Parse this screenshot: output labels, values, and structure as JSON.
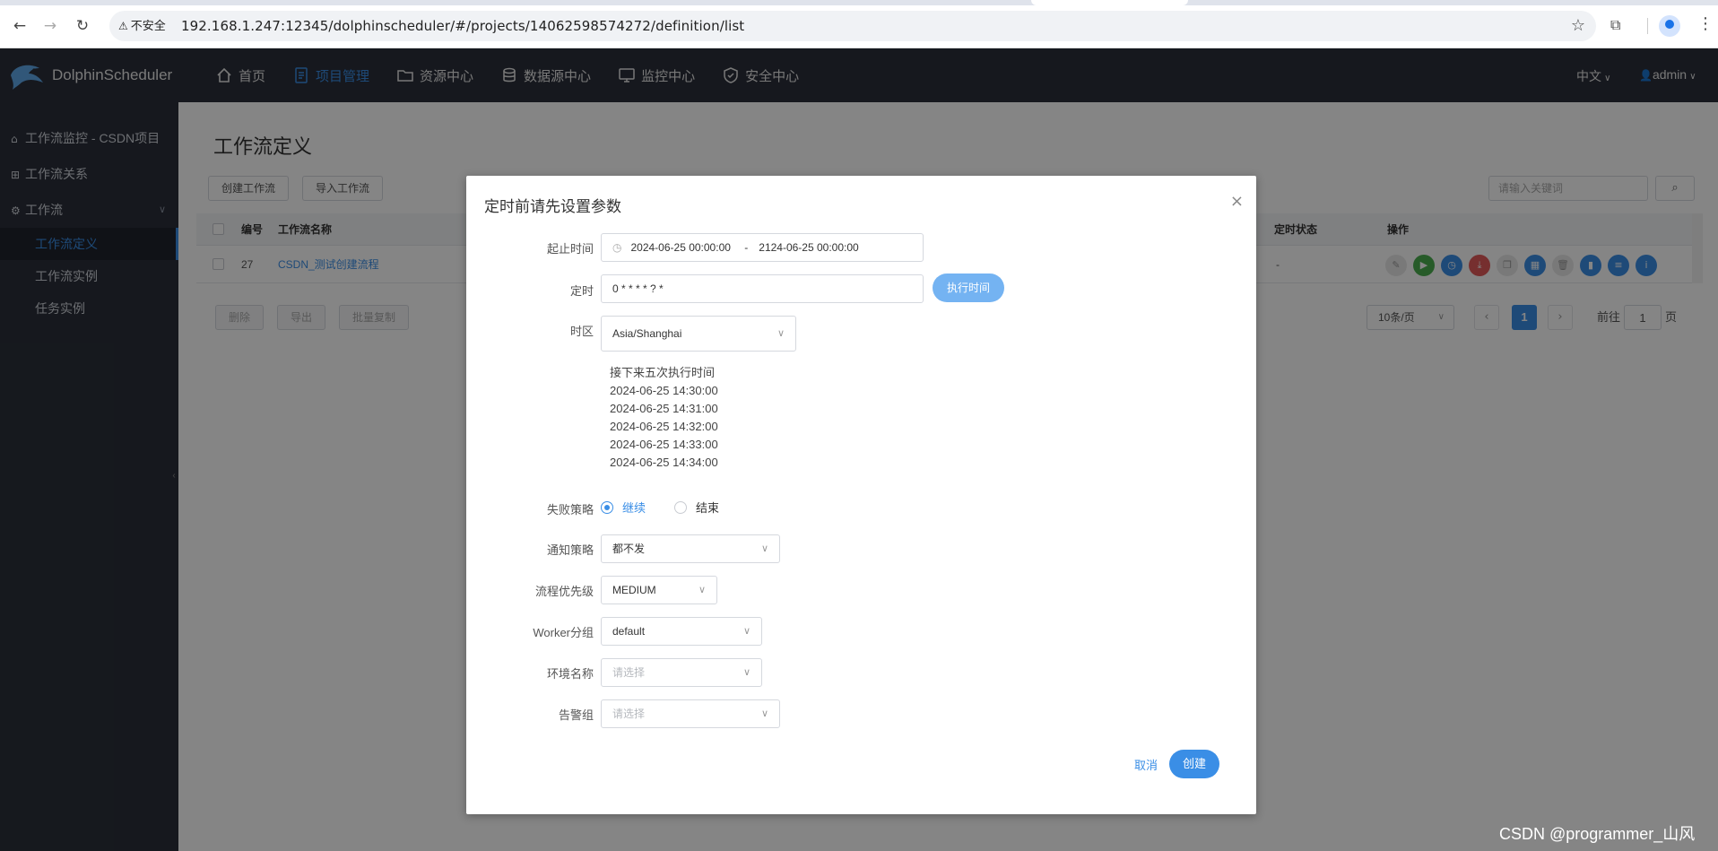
{
  "browser": {
    "security_label": "不安全",
    "url": "192.168.1.247:12345/dolphinscheduler/#/projects/14062598574272/definition/list"
  },
  "header": {
    "brand": "DolphinScheduler",
    "nav": [
      {
        "label": "首页",
        "icon": "home-icon"
      },
      {
        "label": "项目管理",
        "icon": "project-icon",
        "active": true
      },
      {
        "label": "资源中心",
        "icon": "folder-icon"
      },
      {
        "label": "数据源中心",
        "icon": "database-icon"
      },
      {
        "label": "监控中心",
        "icon": "monitor-icon"
      },
      {
        "label": "安全中心",
        "icon": "shield-icon"
      }
    ],
    "language": "中文",
    "user": "admin"
  },
  "sidebar": {
    "items": [
      {
        "label": "工作流监控 - CSDN项目",
        "icon": "home-icon"
      },
      {
        "label": "工作流关系",
        "icon": "tree-icon"
      },
      {
        "label": "工作流",
        "icon": "gear-icon"
      }
    ],
    "sub_items": [
      {
        "label": "工作流定义",
        "active": true
      },
      {
        "label": "工作流实例"
      },
      {
        "label": "任务实例"
      }
    ]
  },
  "main": {
    "title": "工作流定义",
    "create_button": "创建工作流",
    "import_button": "导入工作流",
    "search_placeholder": "请输入关键词",
    "table": {
      "headers": [
        "编号",
        "工作流名称",
        "定时状态",
        "操作"
      ],
      "rows": [
        {
          "id": "27",
          "name": "CSDN_测试创建流程",
          "schedule_status": "-"
        }
      ]
    },
    "bulk_actions": [
      "删除",
      "导出",
      "批量复制"
    ],
    "pagination": {
      "page_size": "10条/页",
      "current_page": "1",
      "goto_label": "前往",
      "goto_value": "1",
      "page_suffix": "页"
    }
  },
  "modal": {
    "title": "定时前请先设置参数",
    "fields": {
      "time_range_label": "起止时间",
      "start_time": "2024-06-25 00:00:00",
      "range_separator": "-",
      "end_time": "2124-06-25 00:00:00",
      "cron_label": "定时",
      "cron_value": "0 * * * * ? *",
      "exec_time_button": "执行时间",
      "timezone_label": "时区",
      "timezone_value": "Asia/Shanghai",
      "next_times_title": "接下来五次执行时间",
      "next_times": [
        "2024-06-25 14:30:00",
        "2024-06-25 14:31:00",
        "2024-06-25 14:32:00",
        "2024-06-25 14:33:00",
        "2024-06-25 14:34:00"
      ],
      "failure_label": "失败策略",
      "failure_continue": "继续",
      "failure_end": "结束",
      "notify_label": "通知策略",
      "notify_value": "都不发",
      "priority_label": "流程优先级",
      "priority_value": "MEDIUM",
      "worker_label": "Worker分组",
      "worker_value": "default",
      "env_label": "环境名称",
      "env_placeholder": "请选择",
      "alert_label": "告警组",
      "alert_placeholder": "请选择"
    },
    "cancel": "取消",
    "create": "创建"
  },
  "watermark": "CSDN @programmer_山风",
  "colors": {
    "header_bg": "#2b2f3a",
    "accent": "#3a8ee6",
    "exec_button": "#74b3f2"
  }
}
